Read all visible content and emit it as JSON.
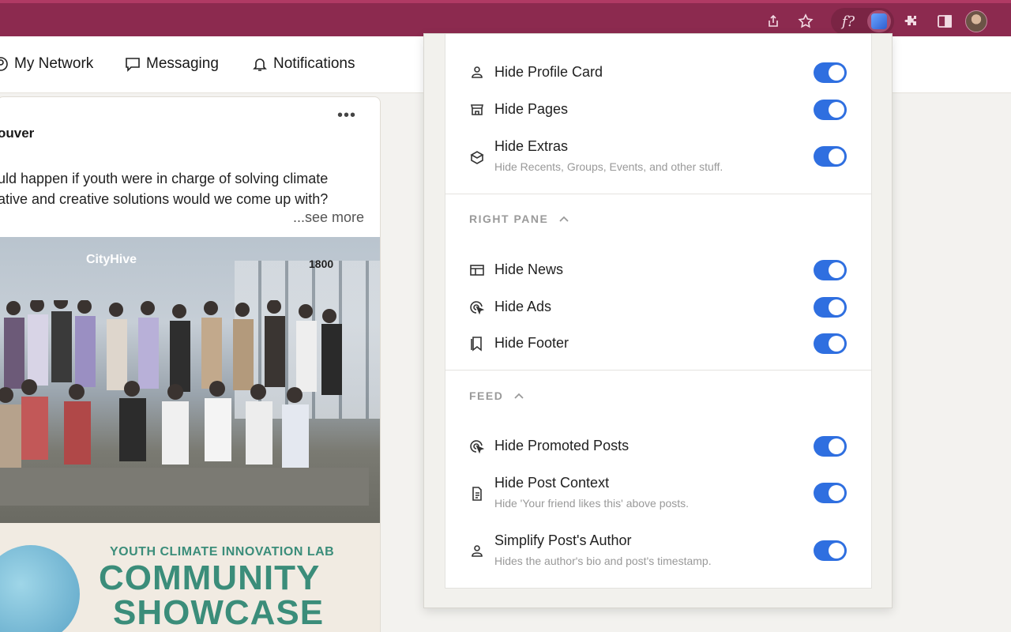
{
  "nav": {
    "items": [
      {
        "label": "My Network",
        "icon": "network-icon"
      },
      {
        "label": "Messaging",
        "icon": "messaging-icon"
      },
      {
        "label": "Notifications",
        "icon": "bell-icon"
      }
    ]
  },
  "post": {
    "more": "•••",
    "author": "ouver",
    "line1": "uld happen if youth were in charge of solving climate",
    "line2": "ative and creative solutions would we come up with?",
    "see_more": "...see more",
    "photo_logo": "CityHive",
    "photo_address": "1800",
    "banner_line1": "YOUTH CLIMATE INNOVATION LAB",
    "banner_line2": "COMMUNITY",
    "banner_line3": "SHOWCASE"
  },
  "popup": {
    "toggles": [
      {
        "label": "Hide Profile Card",
        "on": true
      },
      {
        "label": "Hide Pages",
        "on": true
      },
      {
        "label": "Hide Extras",
        "sub": "Hide Recents, Groups, Events, and other stuff.",
        "on": true
      },
      {
        "label": "Hide News",
        "on": true
      },
      {
        "label": "Hide Ads",
        "on": true
      },
      {
        "label": "Hide Footer",
        "on": true
      },
      {
        "label": "Hide Promoted Posts",
        "on": true
      },
      {
        "label": "Hide Post Context",
        "sub": "Hide 'Your friend likes this' above posts.",
        "on": true
      },
      {
        "label": "Simplify Post's Author",
        "sub": "Hides the author's bio and post's timestamp.",
        "on": true
      }
    ],
    "sections": {
      "right_pane": "RIGHT PANE",
      "feed": "FEED"
    }
  },
  "colors": {
    "chrome": "#8c2a4f",
    "toggle_on": "#2f6fe0",
    "banner_text": "#3b8d7a"
  }
}
